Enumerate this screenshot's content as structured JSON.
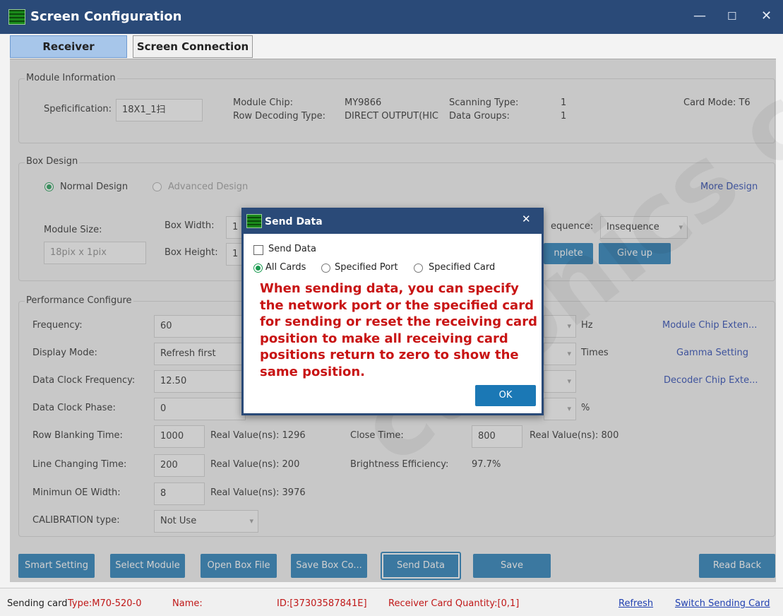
{
  "window": {
    "title": "Screen Configuration",
    "minimize": "—",
    "maximize": "☐",
    "close": "✕"
  },
  "tabs": [
    {
      "label": "Receiver"
    },
    {
      "label": "Screen Connection"
    }
  ],
  "module_info": {
    "group_title": "Module Information",
    "spec_label": "Speficification:",
    "spec_value": "18X1_1扫",
    "chip_label": "Module Chip:",
    "chip_value": "MY9866",
    "row_decoding_label": "Row Decoding Type:",
    "row_decoding_value": "DIRECT OUTPUT(HIC",
    "scanning_label": "Scanning Type:",
    "scanning_value": "1",
    "data_groups_label": "Data Groups:",
    "data_groups_value": "1",
    "card_mode": "Card Mode:  T6"
  },
  "box_design": {
    "group_title": "Box Design",
    "normal": "Normal Design",
    "advanced": "Advanced Design",
    "more": "More Design",
    "module_size_label": "Module Size:",
    "module_size_value": "18pix x 1pix",
    "box_width_label": "Box Width:",
    "box_width_value": "1",
    "box_height_label": "Box Height:",
    "box_height_value": "1",
    "sequence_label": "equence:",
    "sequence_value": "Insequence",
    "complete": "nplete",
    "give_up": "Give up"
  },
  "performance": {
    "group_title": "Performance Configure",
    "frequency_label": "Frequency:",
    "frequency_value": "60",
    "hz": "Hz",
    "display_mode_label": "Display Mode:",
    "display_mode_value": "Refresh first",
    "times": "Times",
    "clock_freq_label": "Data Clock Frequency:",
    "clock_freq_value": "12.50",
    "clock_phase_label": "Data Clock Phase:",
    "clock_phase_value": "0",
    "percent": "%",
    "row_blank_label": "Row Blanking Time:",
    "row_blank_value": "1000",
    "row_blank_real": "Real Value(ns): 1296",
    "close_time_label": "Close Time:",
    "close_time_value": "800",
    "close_time_real": "Real Value(ns): 800",
    "line_change_label": "Line Changing Time:",
    "line_change_value": "200",
    "line_change_real": "Real Value(ns): 200",
    "brightness_label": "Brightness Efficiency:",
    "brightness_value": "97.7%",
    "min_oe_label": "Minimun OE Width:",
    "min_oe_value": "8",
    "min_oe_real": "Real Value(ns): 3976",
    "calibration_label": "CALIBRATION type:",
    "calibration_value": "Not Use",
    "module_chip_ext": "Module Chip Exten...",
    "gamma": "Gamma Setting",
    "decoder_ext": "Decoder Chip Exte..."
  },
  "buttons": {
    "smart_setting": "Smart Setting",
    "select_module": "Select Module",
    "open_box": "Open Box File",
    "save_box": "Save Box Co...",
    "send_data": "Send Data",
    "save": "Save",
    "read_back": "Read Back"
  },
  "status": {
    "sending_card": "Sending card",
    "type": "Type:M70-520-0",
    "name": "Name:",
    "id": "ID:[37303587841E]",
    "quantity": "Receiver Card Quantity:[0,1]",
    "refresh": "Refresh",
    "switch": "Switch Sending Card"
  },
  "dialog": {
    "title": "Send Data",
    "close": "✕",
    "checkbox": "Send Data",
    "radio_all": "All Cards",
    "radio_port": "Specified Port",
    "radio_card": "Specified Card",
    "message_lines": [
      "When sending data, you can specify",
      "the network port or the specified card",
      "for sending or reset the receiving card",
      "position to make all receiving card",
      "positions return to zero to show the",
      "same position."
    ],
    "ok": "OK"
  },
  "watermark": "ctronics co.,",
  "colors": {
    "titlebar": "#2a4a78",
    "button": "#1b78b5",
    "message": "#c81414",
    "link": "#1f3fb0"
  }
}
